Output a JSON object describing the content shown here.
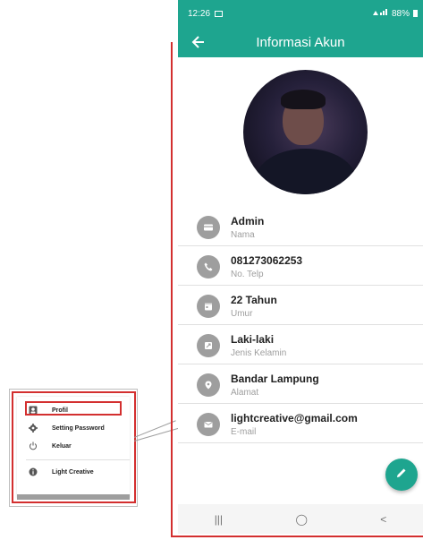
{
  "status_bar": {
    "time": "12:26",
    "battery": "88%"
  },
  "app_bar": {
    "title": "Informasi Akun"
  },
  "profile": {
    "items": [
      {
        "value": "Admin",
        "label": "Nama",
        "icon": "card-icon"
      },
      {
        "value": "081273062253",
        "label": "No. Telp",
        "icon": "phone-icon"
      },
      {
        "value": "22 Tahun",
        "label": "Umur",
        "icon": "calendar-icon"
      },
      {
        "value": "Laki-laki",
        "label": "Jenis Kelamin",
        "icon": "gender-icon"
      },
      {
        "value": "Bandar Lampung",
        "label": "Alamat",
        "icon": "location-icon"
      },
      {
        "value": "lightcreative@gmail.com",
        "label": "E-mail",
        "icon": "mail-icon"
      }
    ]
  },
  "nav_bar": {
    "recents": "|||",
    "home": "◯",
    "back": "<"
  },
  "menu": {
    "items": [
      {
        "label": "Profil",
        "icon": "person-icon"
      },
      {
        "label": "Setting Password",
        "icon": "gear-icon"
      },
      {
        "label": "Keluar",
        "icon": "power-icon"
      },
      {
        "label": "Light Creative",
        "icon": "info-icon"
      }
    ]
  },
  "colors": {
    "accent": "#1ea58f",
    "highlight": "#d32f2f",
    "icon_bg": "#9e9e9e"
  }
}
